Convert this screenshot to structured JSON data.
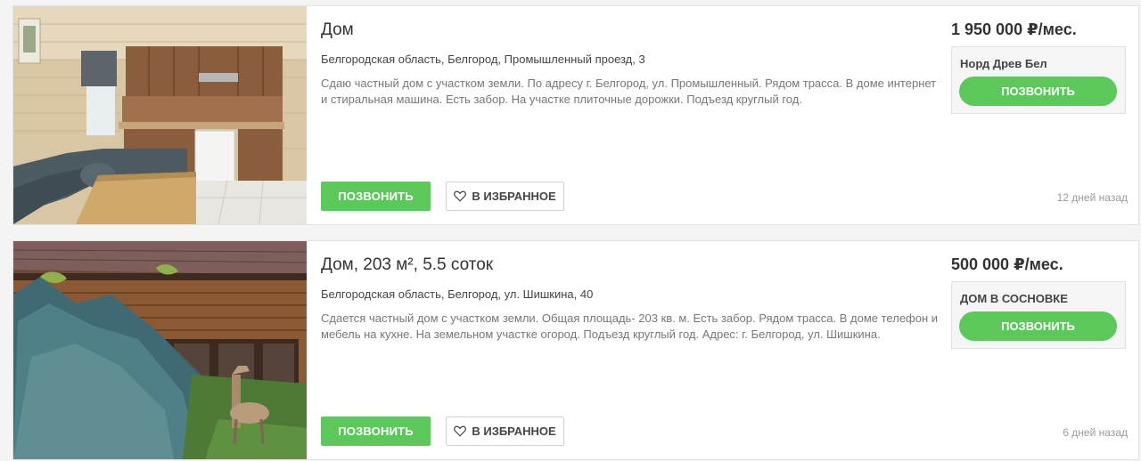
{
  "listings": [
    {
      "title": "Дом",
      "address": "Белгородская область, Белгород, Промышленный проезд, 3",
      "description": "Сдаю частный дом с участком земли. По адресу г. Белгород, ул. Промышленный. Рядом трасса. В доме интернет и стиральная машина. Есть забор. На участке плиточные дорожки. Подъезд круглый год.",
      "price": "1 950 000 ₽/мес.",
      "agent": "Норд Древ Бел",
      "agent_call_label": "ПОЗВОНИТЬ",
      "call_label": "ПОЗВОНИТЬ",
      "favorite_label": "В ИЗБРАННОЕ",
      "date": "12 дней назад"
    },
    {
      "title": "Дом, 203 м², 5.5 соток",
      "address": "Белгородская область, Белгород, ул. Шишкина, 40",
      "description": "Сдается частный дом с участком земли. Общая площадь- 203 кв. м. Есть забор. Рядом трасса. В доме телефон и мебель на кухне. На земельном участке огород. Подъезд круглый год. Адрес: г. Белгород, ул. Шишкина.",
      "price": "500 000 ₽/мес.",
      "agent": "ДОМ В СОСНОВКЕ",
      "agent_call_label": "ПОЗВОНИТЬ",
      "call_label": "ПОЗВОНИТЬ",
      "favorite_label": "В ИЗБРАННОЕ",
      "date": "6 дней назад"
    }
  ],
  "colors": {
    "accent_green": "#5bc85a",
    "card_bg": "#ffffff",
    "page_bg": "#f4f4f4",
    "muted_text": "#777777"
  },
  "icons": [
    "heart-icon"
  ]
}
